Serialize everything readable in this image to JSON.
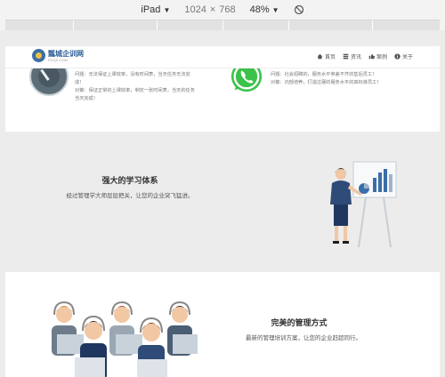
{
  "devtools": {
    "device": "iPad",
    "width": "1024",
    "times": "×",
    "height": "768",
    "zoom": "48%"
  },
  "header": {
    "logo_title": "瓢城企训网",
    "logo_sub": "PCQX.COM",
    "nav": [
      "首页",
      "资讯",
      "案例",
      "关于"
    ]
  },
  "section1": {
    "left_lines": [
      "问题：无法保证上课效率，没有时间表，当天任务无法完",
      "成！",
      "对策：保证正常的上课效率，制定一张时间表，当天的任务",
      "当天完成！"
    ],
    "right_lines": [
      "问题：社会招聘的，服务水平参差不齐的售后员工！",
      "对策：内部培养，打造过硬的服务水平的高标准员工！"
    ]
  },
  "section2": {
    "title": "强大的学习体系",
    "subtitle": "经过管理学大师层层把关，让您的企业突飞猛进。"
  },
  "section3": {
    "title": "完美的管理方式",
    "subtitle": "最新的管理培训方案，让您的企业赶超同行。"
  },
  "colors": {
    "brand": "#2b5d97",
    "band": "#ececec",
    "whatsapp": "#3cc24a"
  }
}
